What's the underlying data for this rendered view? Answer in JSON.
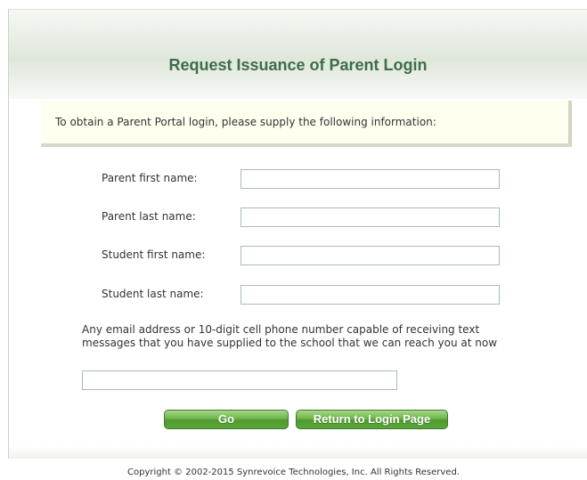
{
  "page": {
    "title": "Request Issuance of Parent Login",
    "intro": "To obtain a Parent Portal login, please supply the following information:"
  },
  "form": {
    "parent_first_name": {
      "label": "Parent first name:",
      "value": ""
    },
    "parent_last_name": {
      "label": "Parent last name:",
      "value": ""
    },
    "student_first_name": {
      "label": "Student first name:",
      "value": ""
    },
    "student_last_name": {
      "label": "Student last name:",
      "value": ""
    },
    "contact": {
      "label_line1": "Any email address or 10-digit cell phone number capable of receiving text",
      "label_line2": "messages that you have supplied to the school that we can reach you at now",
      "value": ""
    }
  },
  "buttons": {
    "go_label": "Go",
    "return_label": "Return to Login Page"
  },
  "footer": {
    "copyright": "Copyright © 2002-2015 Synrevoice Technologies, Inc. All Rights Reserved."
  },
  "colors": {
    "title": "#3d6d4a",
    "button_green": "#5aa637",
    "info_box_bg": "#fffff0"
  }
}
